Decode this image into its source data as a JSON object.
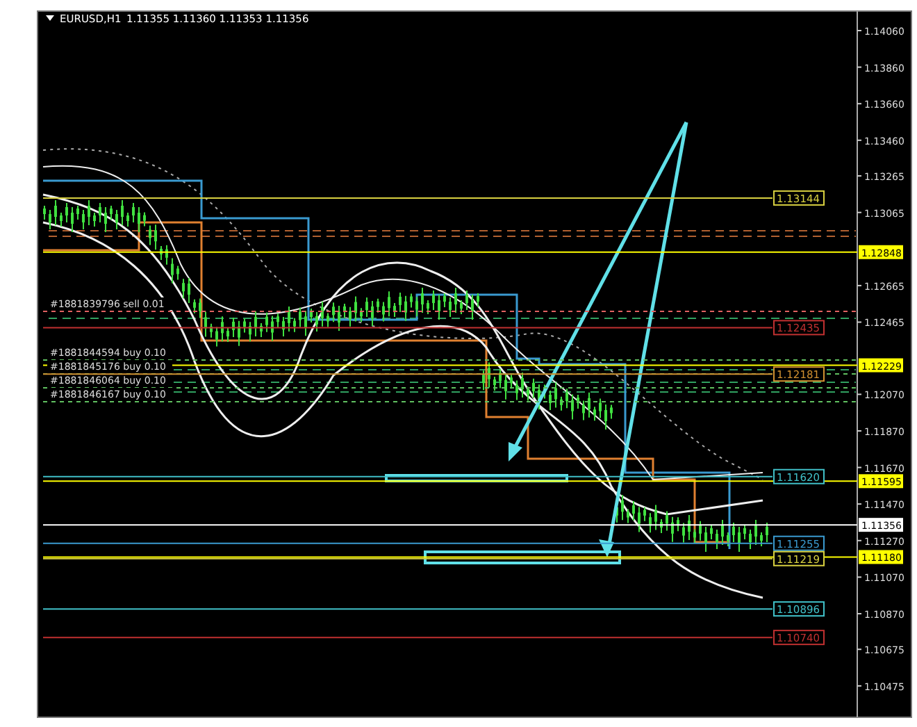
{
  "chart": {
    "symbol": "EURUSD,H1",
    "quote": "1.11355 1.11360 1.11353 1.11356",
    "price_axis": [
      {
        "label": "1.14060"
      },
      {
        "label": "1.13860"
      },
      {
        "label": "1.13660"
      },
      {
        "label": "1.13460"
      },
      {
        "label": "1.13265"
      },
      {
        "label": "1.13065"
      },
      {
        "label": "1.12665"
      },
      {
        "label": "1.12465"
      },
      {
        "label": "1.12070"
      },
      {
        "label": "1.11870"
      },
      {
        "label": "1.11670"
      },
      {
        "label": "1.11470"
      },
      {
        "label": "1.11270"
      },
      {
        "label": "1.11070"
      },
      {
        "label": "1.10870"
      },
      {
        "label": "1.10675"
      },
      {
        "label": "1.10475"
      }
    ],
    "axis_badges": [
      {
        "label": "1.12848",
        "color": "#ffff00"
      },
      {
        "label": "1.12229",
        "color": "#ffff00"
      },
      {
        "label": "1.11595",
        "color": "#ffff00"
      },
      {
        "label": "1.11356",
        "color": "#ffffff"
      },
      {
        "label": "1.11180",
        "color": "#ffff00"
      }
    ],
    "levels": [
      {
        "label": "1.13144",
        "color": "#d8d040"
      },
      {
        "label": "1.12435",
        "color": "#c03030"
      },
      {
        "label": "1.12181",
        "color": "#d09030"
      },
      {
        "label": "1.11620",
        "color": "#40c0c8"
      },
      {
        "label": "1.11255",
        "color": "#3a9ad0"
      },
      {
        "label": "1.11219",
        "color": "#d8d040"
      },
      {
        "label": "1.10896",
        "color": "#40c0c8"
      },
      {
        "label": "1.10740",
        "color": "#c03030"
      }
    ],
    "orders": [
      {
        "label": "#1881839796 sell 0.01",
        "kind": "sell"
      },
      {
        "label": "#1881844594 buy 0.10",
        "kind": "buy"
      },
      {
        "label": "#1881845176 buy 0.10",
        "kind": "buy"
      },
      {
        "label": "#1881846064 buy 0.10",
        "kind": "buy"
      },
      {
        "label": "#1881846167 buy 0.10",
        "kind": "buy"
      }
    ]
  }
}
